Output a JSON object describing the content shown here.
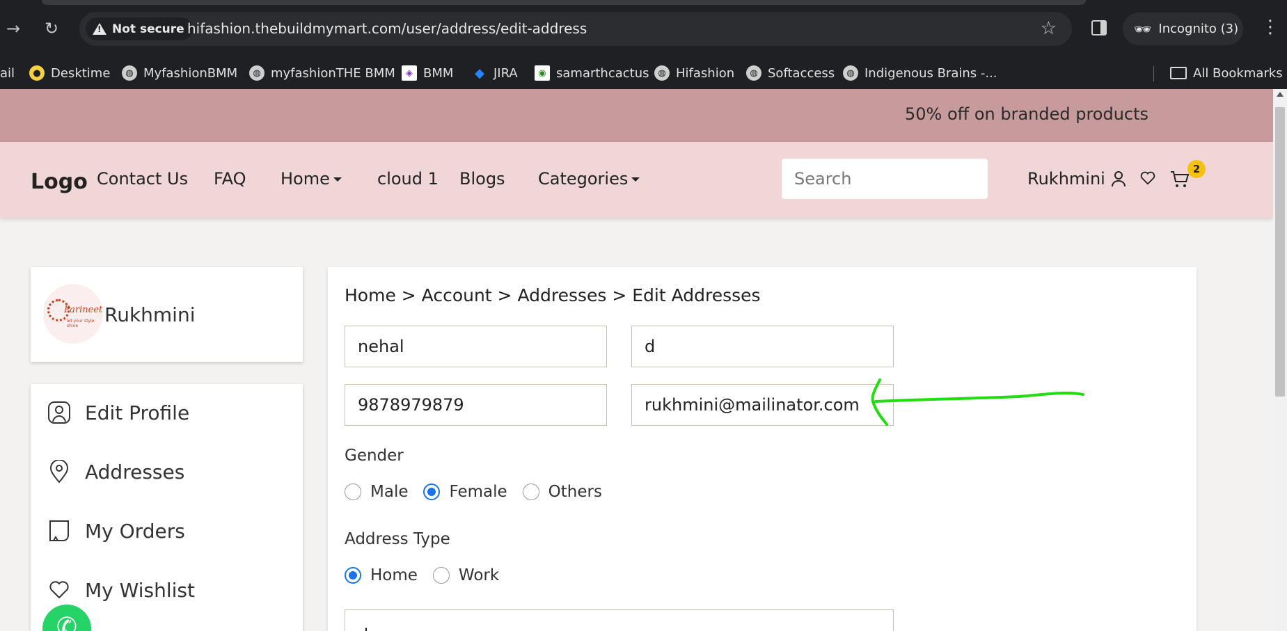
{
  "browser": {
    "security_label": "Not secure",
    "url": "hifashion.thebuildmymart.com/user/address/edit-address",
    "incognito_label": "Incognito (3)",
    "bookmarks": [
      {
        "label": "ail"
      },
      {
        "label": "Desktime"
      },
      {
        "label": "MyfashionBMM"
      },
      {
        "label": "myfashionTHE BMM"
      },
      {
        "label": "BMM"
      },
      {
        "label": "JIRA"
      },
      {
        "label": "samarthcactus"
      },
      {
        "label": "Hifashion"
      },
      {
        "label": "Softaccess"
      },
      {
        "label": "Indigenous Brains -..."
      }
    ],
    "all_bookmarks_label": "All Bookmarks"
  },
  "promo": {
    "text": "50% off on branded products"
  },
  "header": {
    "logo": "Logo",
    "nav": [
      {
        "label": "Contact Us"
      },
      {
        "label": "FAQ"
      },
      {
        "label": "Home"
      },
      {
        "label": "cloud 1"
      },
      {
        "label": "Blogs"
      },
      {
        "label": "Categories"
      }
    ],
    "search_placeholder": "Search",
    "user_name": "Rukhmini",
    "cart_count": "2"
  },
  "sidebar": {
    "profile_name": "Rukhmini",
    "avatar_brand": "Parineeti",
    "avatar_tagline": "let your style shine",
    "menu": [
      {
        "label": "Edit Profile",
        "icon": "user-icon"
      },
      {
        "label": "Addresses",
        "icon": "location-icon"
      },
      {
        "label": "My Orders",
        "icon": "receipt-icon"
      },
      {
        "label": "My Wishlist",
        "icon": "heart-icon"
      }
    ]
  },
  "form": {
    "breadcrumb": "Home > Account > Addresses > Edit Addresses",
    "first_name": "nehal",
    "last_name": "d",
    "phone": "9878979879",
    "email": "rukhmini@mailinator.com",
    "gender_label": "Gender",
    "gender_options": [
      {
        "label": "Male",
        "checked": false
      },
      {
        "label": "Female",
        "checked": true
      },
      {
        "label": "Others",
        "checked": false
      }
    ],
    "address_type_label": "Address Type",
    "address_type_options": [
      {
        "label": "Home",
        "checked": true
      },
      {
        "label": "Work",
        "checked": false
      }
    ],
    "address_line": "dsuyguy"
  },
  "annotation": {
    "arrow_color": "#22dd11"
  },
  "colors": {
    "promo_bg": "#c79a9b",
    "header_bg": "#f0d6d7",
    "radio_accent": "#1a73e8",
    "badge": "#f4c20d"
  }
}
